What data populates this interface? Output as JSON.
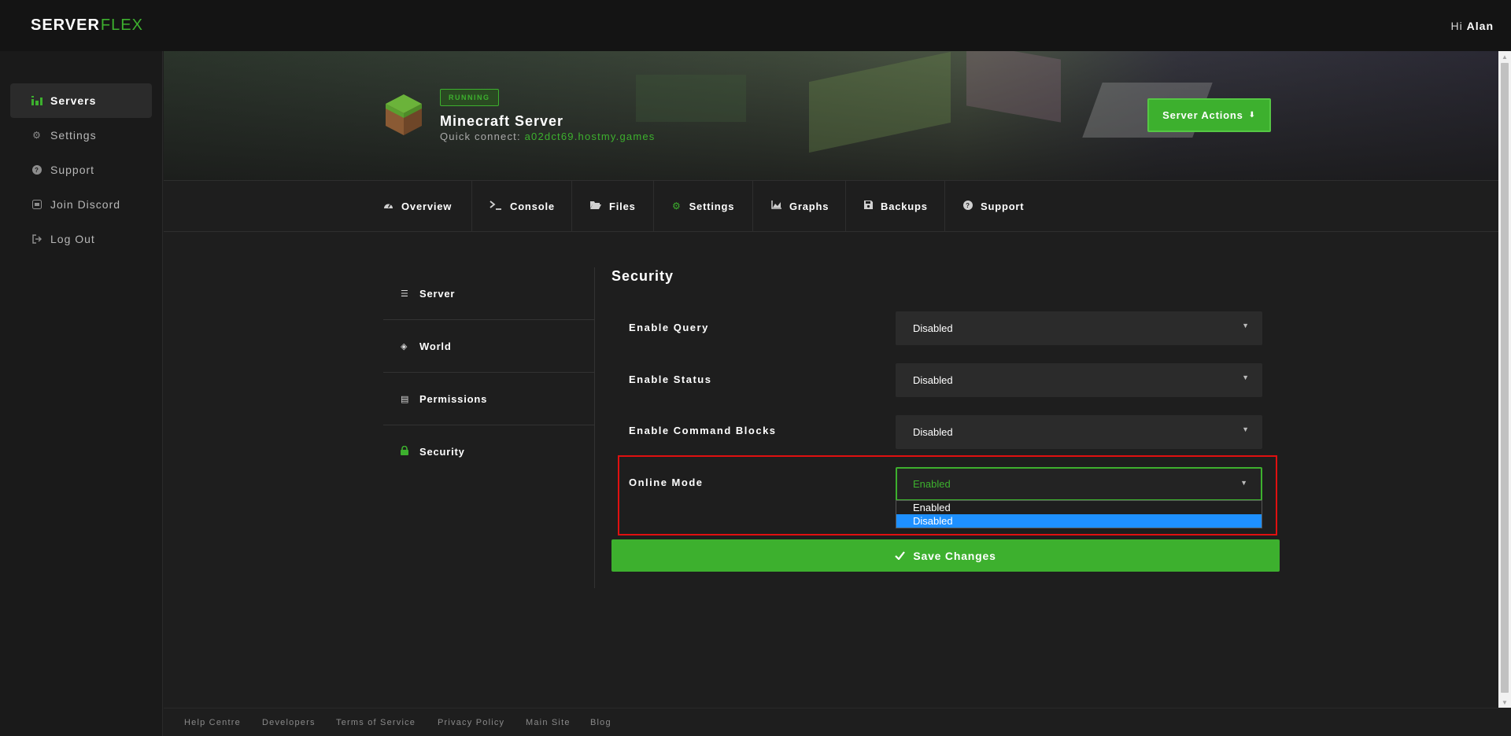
{
  "header": {
    "logo_part1": "SERVER",
    "logo_part2": "FLEX",
    "greeting_prefix": "Hi",
    "user_name": "Alan"
  },
  "sidebar": {
    "items": [
      {
        "label": "Servers",
        "icon": "servers-icon"
      },
      {
        "label": "Settings",
        "icon": "gears-icon"
      },
      {
        "label": "Support",
        "icon": "question-circle-icon"
      },
      {
        "label": "Join Discord",
        "icon": "discord-icon"
      },
      {
        "label": "Log Out",
        "icon": "logout-icon"
      }
    ],
    "active_index": 0
  },
  "server": {
    "status": "RUNNING",
    "name": "Minecraft Server",
    "quick_connect_label": "Quick connect:",
    "host": "a02dct69.hostmy.games",
    "actions_label": "Server Actions"
  },
  "tabs": [
    {
      "label": "Overview",
      "icon": "tachometer-icon"
    },
    {
      "label": "Console",
      "icon": "terminal-icon"
    },
    {
      "label": "Files",
      "icon": "folder-open-icon"
    },
    {
      "label": "Settings",
      "icon": "gear-icon"
    },
    {
      "label": "Graphs",
      "icon": "area-chart-icon"
    },
    {
      "label": "Backups",
      "icon": "floppy-disk-icon"
    },
    {
      "label": "Support",
      "icon": "question-circle-icon"
    }
  ],
  "settings_nav": [
    {
      "label": "Server",
      "icon": "server-icon"
    },
    {
      "label": "World",
      "icon": "layers-icon"
    },
    {
      "label": "Permissions",
      "icon": "list-icon"
    },
    {
      "label": "Security",
      "icon": "lock-icon"
    }
  ],
  "section": {
    "title": "Security",
    "fields": [
      {
        "label": "Enable Query",
        "value": "Disabled"
      },
      {
        "label": "Enable Status",
        "value": "Disabled"
      },
      {
        "label": "Enable Command Blocks",
        "value": "Disabled"
      },
      {
        "label": "Online Mode",
        "value": "Enabled"
      }
    ],
    "dropdown_options": [
      "Enabled",
      "Disabled"
    ],
    "dropdown_highlighted": "Disabled",
    "save_label": "Save Changes"
  },
  "footer": {
    "links": [
      "Help Centre",
      "Developers",
      "Terms of Service",
      "Privacy Policy",
      "Main Site",
      "Blog"
    ]
  },
  "colors": {
    "accent": "#3db02e",
    "highlight_border": "#e01010",
    "option_selected": "#1e90ff"
  }
}
